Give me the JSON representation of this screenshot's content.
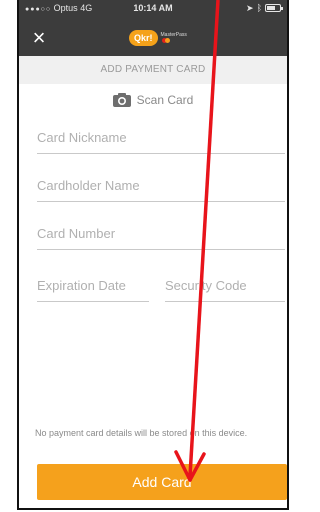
{
  "status_bar": {
    "carrier": "Optus",
    "network": "4G",
    "time": "10:14 AM"
  },
  "app_bar": {
    "logo_text": "Qkr!",
    "logo_sub": "MasterPass"
  },
  "header": {
    "title": "ADD PAYMENT CARD"
  },
  "scan": {
    "label": "Scan Card"
  },
  "form": {
    "nickname_placeholder": "Card Nickname",
    "holder_placeholder": "Cardholder Name",
    "number_placeholder": "Card Number",
    "expiry_placeholder": "Expiration Date",
    "cvv_placeholder": "Security Code"
  },
  "footer": {
    "disclaimer": "No payment card details will be stored on this device.",
    "add_button": "Add Card"
  },
  "colors": {
    "app_bar": "#3c3c3c",
    "accent": "#f5a11c",
    "annotation_arrow": "#e8141b"
  }
}
